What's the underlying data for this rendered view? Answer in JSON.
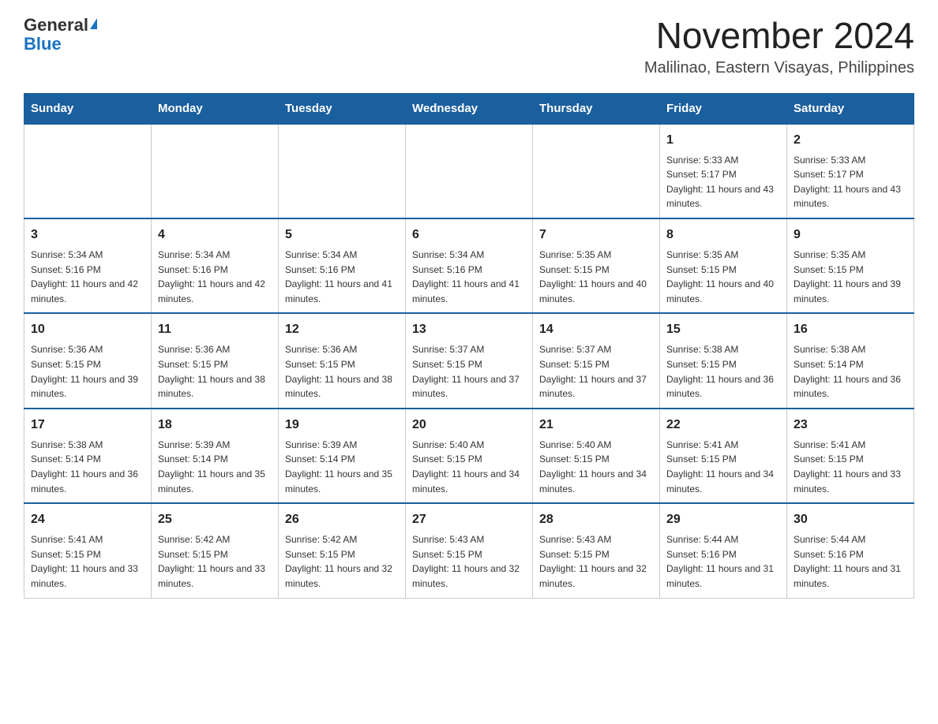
{
  "logo": {
    "general": "General",
    "blue": "Blue"
  },
  "header": {
    "month_year": "November 2024",
    "location": "Malilinao, Eastern Visayas, Philippines"
  },
  "weekdays": [
    "Sunday",
    "Monday",
    "Tuesday",
    "Wednesday",
    "Thursday",
    "Friday",
    "Saturday"
  ],
  "weeks": [
    [
      {
        "day": "",
        "info": ""
      },
      {
        "day": "",
        "info": ""
      },
      {
        "day": "",
        "info": ""
      },
      {
        "day": "",
        "info": ""
      },
      {
        "day": "",
        "info": ""
      },
      {
        "day": "1",
        "info": "Sunrise: 5:33 AM\nSunset: 5:17 PM\nDaylight: 11 hours and 43 minutes."
      },
      {
        "day": "2",
        "info": "Sunrise: 5:33 AM\nSunset: 5:17 PM\nDaylight: 11 hours and 43 minutes."
      }
    ],
    [
      {
        "day": "3",
        "info": "Sunrise: 5:34 AM\nSunset: 5:16 PM\nDaylight: 11 hours and 42 minutes."
      },
      {
        "day": "4",
        "info": "Sunrise: 5:34 AM\nSunset: 5:16 PM\nDaylight: 11 hours and 42 minutes."
      },
      {
        "day": "5",
        "info": "Sunrise: 5:34 AM\nSunset: 5:16 PM\nDaylight: 11 hours and 41 minutes."
      },
      {
        "day": "6",
        "info": "Sunrise: 5:34 AM\nSunset: 5:16 PM\nDaylight: 11 hours and 41 minutes."
      },
      {
        "day": "7",
        "info": "Sunrise: 5:35 AM\nSunset: 5:15 PM\nDaylight: 11 hours and 40 minutes."
      },
      {
        "day": "8",
        "info": "Sunrise: 5:35 AM\nSunset: 5:15 PM\nDaylight: 11 hours and 40 minutes."
      },
      {
        "day": "9",
        "info": "Sunrise: 5:35 AM\nSunset: 5:15 PM\nDaylight: 11 hours and 39 minutes."
      }
    ],
    [
      {
        "day": "10",
        "info": "Sunrise: 5:36 AM\nSunset: 5:15 PM\nDaylight: 11 hours and 39 minutes."
      },
      {
        "day": "11",
        "info": "Sunrise: 5:36 AM\nSunset: 5:15 PM\nDaylight: 11 hours and 38 minutes."
      },
      {
        "day": "12",
        "info": "Sunrise: 5:36 AM\nSunset: 5:15 PM\nDaylight: 11 hours and 38 minutes."
      },
      {
        "day": "13",
        "info": "Sunrise: 5:37 AM\nSunset: 5:15 PM\nDaylight: 11 hours and 37 minutes."
      },
      {
        "day": "14",
        "info": "Sunrise: 5:37 AM\nSunset: 5:15 PM\nDaylight: 11 hours and 37 minutes."
      },
      {
        "day": "15",
        "info": "Sunrise: 5:38 AM\nSunset: 5:15 PM\nDaylight: 11 hours and 36 minutes."
      },
      {
        "day": "16",
        "info": "Sunrise: 5:38 AM\nSunset: 5:14 PM\nDaylight: 11 hours and 36 minutes."
      }
    ],
    [
      {
        "day": "17",
        "info": "Sunrise: 5:38 AM\nSunset: 5:14 PM\nDaylight: 11 hours and 36 minutes."
      },
      {
        "day": "18",
        "info": "Sunrise: 5:39 AM\nSunset: 5:14 PM\nDaylight: 11 hours and 35 minutes."
      },
      {
        "day": "19",
        "info": "Sunrise: 5:39 AM\nSunset: 5:14 PM\nDaylight: 11 hours and 35 minutes."
      },
      {
        "day": "20",
        "info": "Sunrise: 5:40 AM\nSunset: 5:15 PM\nDaylight: 11 hours and 34 minutes."
      },
      {
        "day": "21",
        "info": "Sunrise: 5:40 AM\nSunset: 5:15 PM\nDaylight: 11 hours and 34 minutes."
      },
      {
        "day": "22",
        "info": "Sunrise: 5:41 AM\nSunset: 5:15 PM\nDaylight: 11 hours and 34 minutes."
      },
      {
        "day": "23",
        "info": "Sunrise: 5:41 AM\nSunset: 5:15 PM\nDaylight: 11 hours and 33 minutes."
      }
    ],
    [
      {
        "day": "24",
        "info": "Sunrise: 5:41 AM\nSunset: 5:15 PM\nDaylight: 11 hours and 33 minutes."
      },
      {
        "day": "25",
        "info": "Sunrise: 5:42 AM\nSunset: 5:15 PM\nDaylight: 11 hours and 33 minutes."
      },
      {
        "day": "26",
        "info": "Sunrise: 5:42 AM\nSunset: 5:15 PM\nDaylight: 11 hours and 32 minutes."
      },
      {
        "day": "27",
        "info": "Sunrise: 5:43 AM\nSunset: 5:15 PM\nDaylight: 11 hours and 32 minutes."
      },
      {
        "day": "28",
        "info": "Sunrise: 5:43 AM\nSunset: 5:15 PM\nDaylight: 11 hours and 32 minutes."
      },
      {
        "day": "29",
        "info": "Sunrise: 5:44 AM\nSunset: 5:16 PM\nDaylight: 11 hours and 31 minutes."
      },
      {
        "day": "30",
        "info": "Sunrise: 5:44 AM\nSunset: 5:16 PM\nDaylight: 11 hours and 31 minutes."
      }
    ]
  ]
}
